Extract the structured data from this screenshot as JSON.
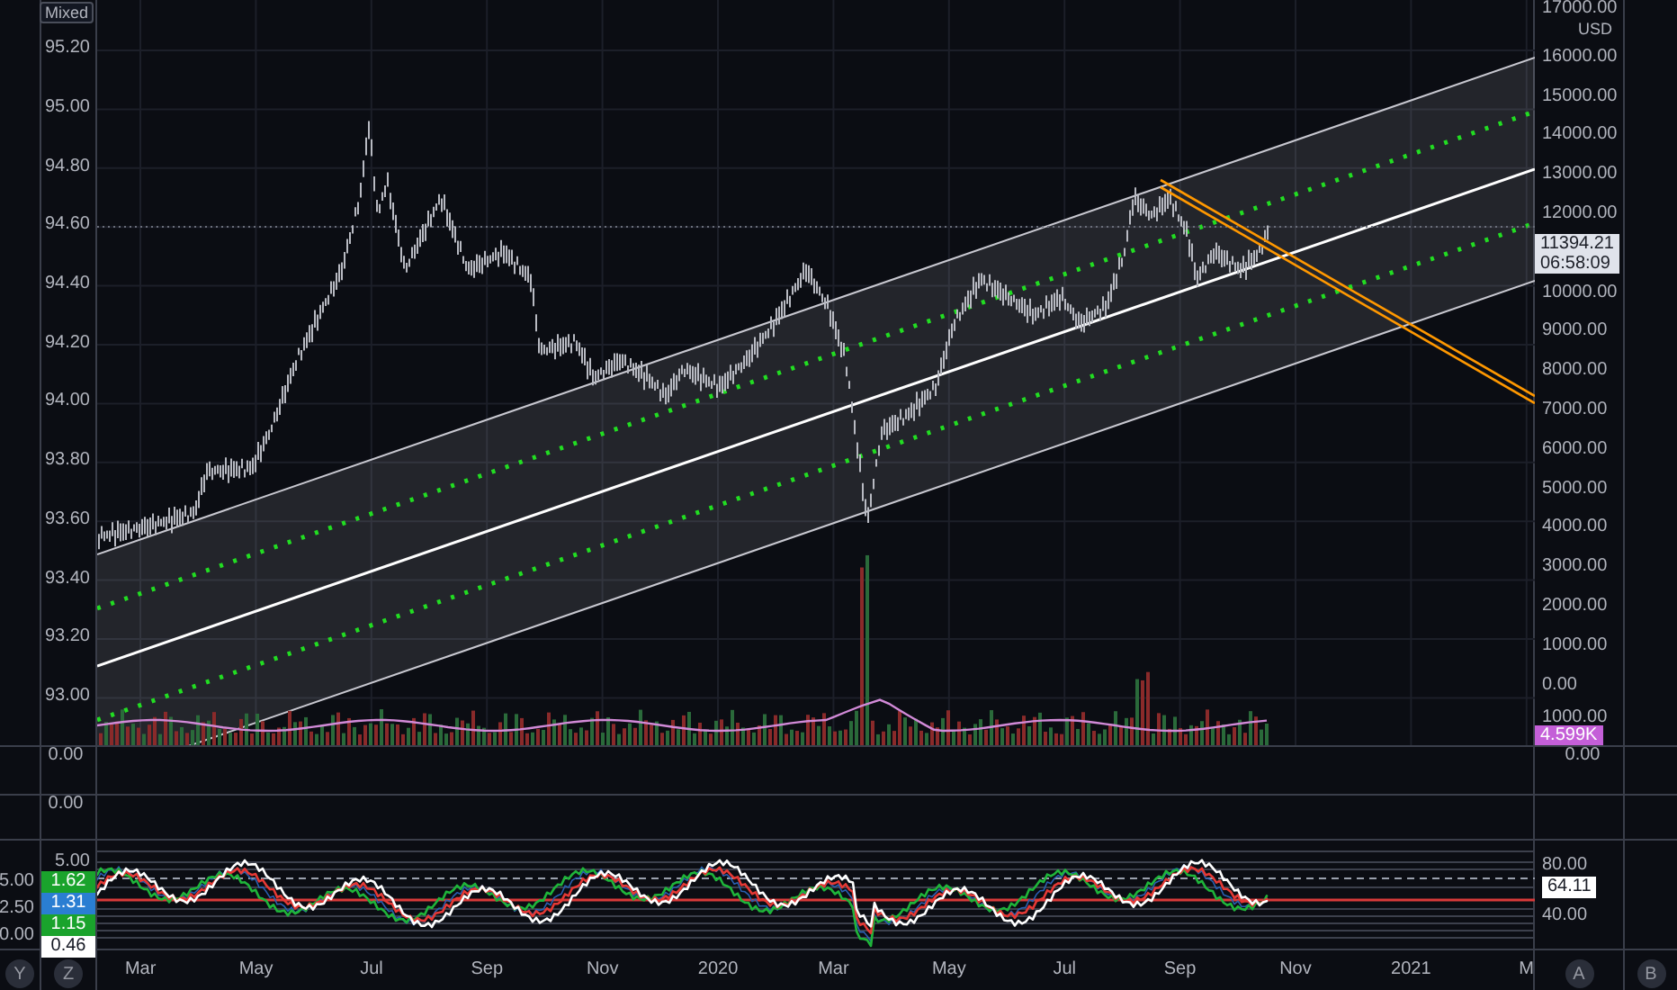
{
  "main_pane": {
    "scale_mode": "Mixed",
    "left_axis": [
      "95.20",
      "95.00",
      "94.80",
      "94.60",
      "94.40",
      "94.20",
      "94.00",
      "93.80",
      "93.60",
      "93.40",
      "93.20",
      "93.00"
    ],
    "currency": "USD",
    "right_axis": [
      "17000.00",
      "16000.00",
      "15000.00",
      "14000.00",
      "13000.00",
      "12000.00",
      "10000.00",
      "9000.00",
      "8000.00",
      "7000.00",
      "6000.00",
      "5000.00",
      "4000.00",
      "3000.00",
      "2000.00",
      "1000.00",
      "0.00",
      "1000.00"
    ],
    "price_badge": "11394.21",
    "countdown_badge": "06:58:09",
    "volume_badge": "4.599K"
  },
  "pane_2": {
    "left_label": "0.00",
    "right_label": "0.00"
  },
  "pane_3": {
    "left_label": "0.00"
  },
  "oscillator_pane": {
    "outer_axis": [
      "5.00",
      "2.50",
      "0.00"
    ],
    "inner_axis": [
      "5.00"
    ],
    "value_badges": [
      {
        "value": "1.62",
        "color": "#1aa32c"
      },
      {
        "value": "1.31",
        "color": "#2a7ed2"
      },
      {
        "value": "1.15",
        "color": "#1aa32c"
      },
      {
        "value": "0.46",
        "color": "#ffffff"
      }
    ],
    "right_axis": [
      "80.00",
      "40.00"
    ],
    "value_badge": "64.11"
  },
  "time_axis": [
    "Mar",
    "May",
    "Jul",
    "Sep",
    "Nov",
    "2020",
    "Mar",
    "May",
    "Jul",
    "Sep",
    "Nov",
    "2021",
    "M"
  ],
  "scale_buttons": [
    "Y",
    "Z",
    "A",
    "B"
  ]
}
